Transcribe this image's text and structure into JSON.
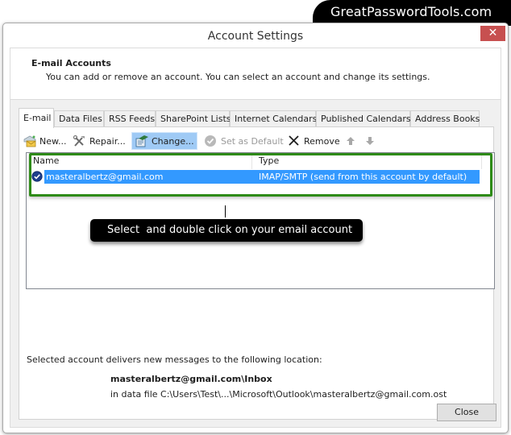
{
  "brand": {
    "text": "GreatPasswordTools.com"
  },
  "window": {
    "title": "Account Settings",
    "close_icon": "close-icon"
  },
  "header": {
    "title": "E-mail Accounts",
    "description": "You can add or remove an account. You can select an account and change its settings."
  },
  "tabs": [
    {
      "label": "E-mail",
      "active": true
    },
    {
      "label": "Data Files",
      "active": false
    },
    {
      "label": "RSS Feeds",
      "active": false
    },
    {
      "label": "SharePoint Lists",
      "active": false
    },
    {
      "label": "Internet Calendars",
      "active": false
    },
    {
      "label": "Published Calendars",
      "active": false
    },
    {
      "label": "Address Books",
      "active": false
    }
  ],
  "toolbar": {
    "new_label": "New...",
    "repair_label": "Repair...",
    "change_label": "Change...",
    "set_default_label": "Set as Default",
    "remove_label": "Remove",
    "move_up_icon": "arrow-up-icon",
    "move_down_icon": "arrow-down-icon"
  },
  "account_list": {
    "columns": [
      "Name",
      "Type"
    ],
    "rows": [
      {
        "name": "masteralbertz@gmail.com",
        "type": "IMAP/SMTP (send from this account by default)",
        "selected": true,
        "default": true
      }
    ]
  },
  "callout": {
    "text": "Select  and double click on your email account"
  },
  "delivery": {
    "label": "Selected account delivers new messages to the following location:",
    "folder": "masteralbertz@gmail.com\\Inbox",
    "data_file": "in data file C:\\Users\\Test\\...\\Microsoft\\Outlook\\masteralbertz@gmail.com.ost"
  },
  "footer": {
    "close_label": "Close"
  },
  "colors": {
    "selection": "#3399ff",
    "highlight_frame": "#2e8b18",
    "close_button": "#c75050",
    "hot_button": "#9fcaf5"
  }
}
